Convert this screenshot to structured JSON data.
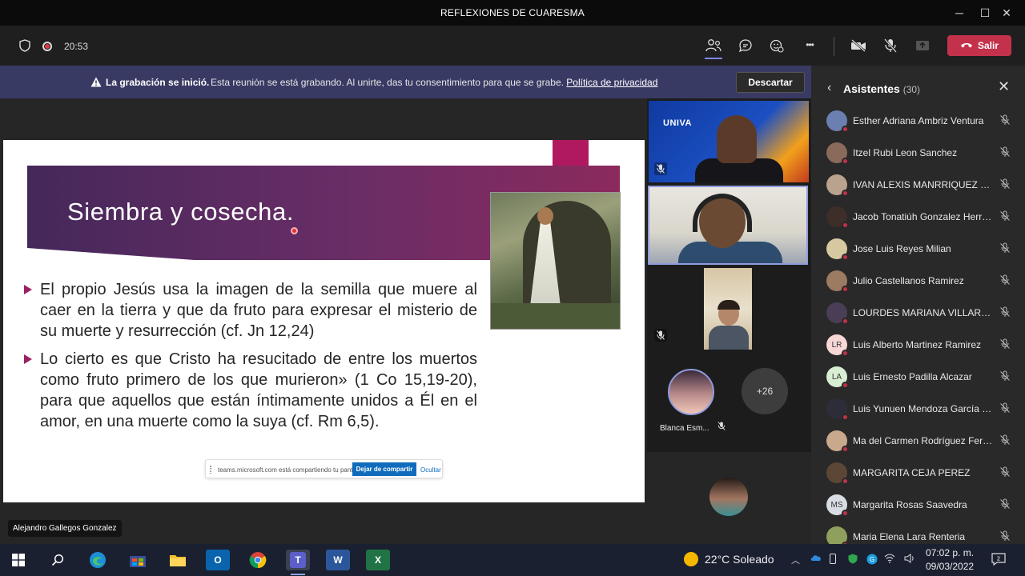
{
  "window": {
    "title": "REFLEXIONES DE CUARESMA",
    "minimize_glyph": "─",
    "maximize_glyph": "☐",
    "close_glyph": "✕"
  },
  "toolbar": {
    "timer": "20:53",
    "leave_label": "Salir",
    "more_glyph": "•••",
    "icons": [
      "shield-icon",
      "recording-icon",
      "people-icon",
      "chat-icon",
      "reactions-icon",
      "more-options-icon",
      "camera-off-icon",
      "mic-off-icon",
      "share-tray-icon",
      "phone-icon"
    ]
  },
  "banner": {
    "title": "La grabación se inició.",
    "text": "Esta reunión se está grabando. Al unirte, das tu consentimiento para que se grabe.",
    "link": "Política de privacidad",
    "dismiss_label": "Descartar"
  },
  "slide": {
    "title": "Siembra y cosecha.",
    "bullets": [
      "El propio Jesús usa la imagen de la semilla que muere al caer en la tierra y que da fruto para expresar el misterio de su muerte y resurrección (cf. Jn 12,24)",
      "Lo cierto es que Cristo ha resucitado de entre los muertos como fruto primero de los que murieron» (1 Co 15,19-20), para que aquellos que están íntimamente unidos a Él en el amor, en una muerte como la suya (cf. Rm 6,5)."
    ],
    "accent_color": "#9b1f62"
  },
  "sharebar": {
    "text": "teams.microsoft.com está compartiendo tu pantalla.",
    "stop_label": "Dejar de compartir",
    "hide_label": "Ocultar"
  },
  "presenter_name": "Alejandro Gallegos Gonzalez",
  "gallery": {
    "tile1_logo": "UNIVA",
    "blanca_name": "Blanca Esm...",
    "more_count": "+26"
  },
  "participants_panel": {
    "title": "Asistentes",
    "count": "(30)",
    "people": [
      {
        "name": "Esther Adriana Ambriz Ventura",
        "initials": "",
        "color": "#6b7fb0"
      },
      {
        "name": "Itzel Rubi Leon Sanchez",
        "initials": "",
        "color": "#8a6a5a"
      },
      {
        "name": "IVAN ALEXIS MANRRIQUEZ OR...",
        "initials": "",
        "color": "#b9a38f"
      },
      {
        "name": "Jacob Tonatiúh Gonzalez Herrera",
        "initials": "",
        "color": "#3d2e2a"
      },
      {
        "name": "Jose Luis Reyes Milian",
        "initials": "",
        "color": "#d6c9a1"
      },
      {
        "name": "Julio Castellanos Ramirez",
        "initials": "",
        "color": "#9b7b62"
      },
      {
        "name": "LOURDES MARIANA VILLAR DU...",
        "initials": "",
        "color": "#4a3e57"
      },
      {
        "name": "Luis Alberto Martinez Ramirez",
        "initials": "LR",
        "color": "#f8d7d7"
      },
      {
        "name": "Luis Ernesto Padilla Alcazar",
        "initials": "LA",
        "color": "#d8eed3"
      },
      {
        "name": "Luis Yunuen Mendoza García de...",
        "initials": "",
        "color": "#2d2d3a"
      },
      {
        "name": "Ma del Carmen Rodríguez Ferná...",
        "initials": "",
        "color": "#c9a98c"
      },
      {
        "name": "MARGARITA CEJA PEREZ",
        "initials": "",
        "color": "#5c4636"
      },
      {
        "name": "Margarita Rosas Saavedra",
        "initials": "MS",
        "color": "#d9dde3"
      },
      {
        "name": "Maria Elena Lara Renteria",
        "initials": "",
        "color": "#8fa05c"
      }
    ]
  },
  "taskbar": {
    "apps": [
      "windows-start",
      "search",
      "edge",
      "store",
      "file-explorer",
      "outlook",
      "chrome",
      "teams",
      "word",
      "excel"
    ],
    "weather": "22°C  Soleado",
    "time": "07:02 p. m.",
    "date": "09/03/2022",
    "notifications": "2",
    "outlook_letter": "O",
    "teams_letter": "T",
    "word_letter": "W",
    "excel_letter": "X"
  }
}
